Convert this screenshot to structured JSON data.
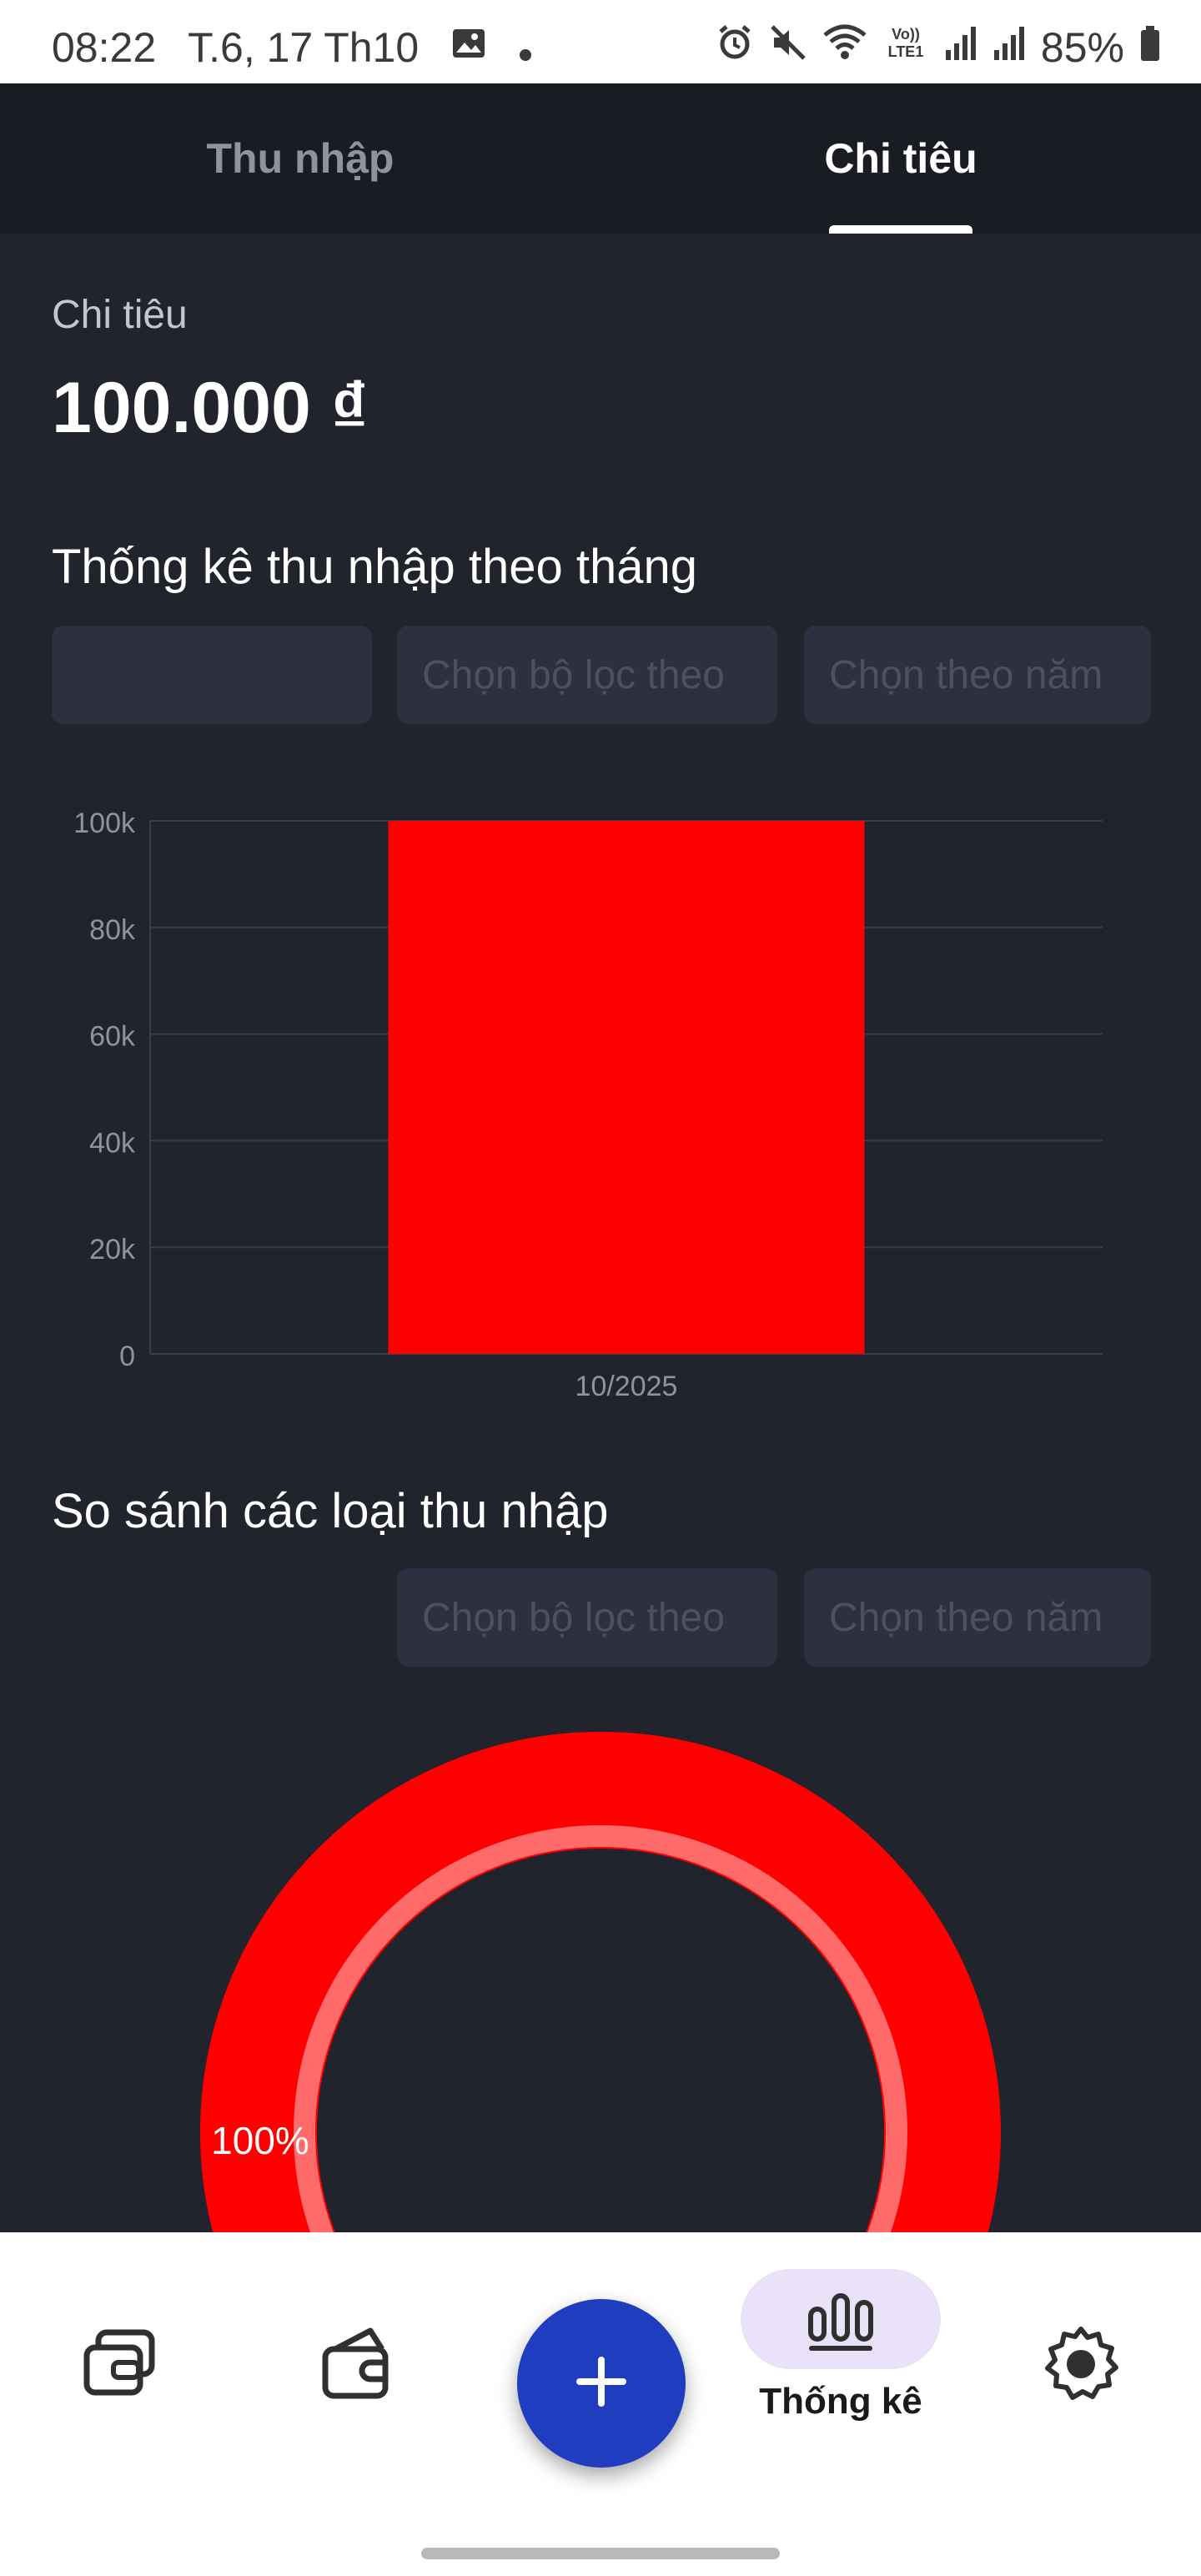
{
  "status_bar": {
    "time": "08:22",
    "date": "T.6, 17 Th10",
    "battery": "85%",
    "icons": [
      "gallery-icon",
      "dot-icon",
      "alarm-icon",
      "mute-icon",
      "wifi-icon",
      "volte-icon",
      "signal-icon",
      "signal-icon",
      "battery-icon"
    ],
    "volte_label": "Vo)) LTE1"
  },
  "tabs": [
    {
      "label": "Thu nhập",
      "active": false
    },
    {
      "label": "Chi tiêu",
      "active": true
    }
  ],
  "summary": {
    "label": "Chi tiêu",
    "amount": "100.000 ₫"
  },
  "monthly_section": {
    "title": "Thống kê thu nhập theo tháng",
    "filter_1": "",
    "filter_2_placeholder": "Chọn bộ lọc theo",
    "filter_3_placeholder": "Chọn theo năm"
  },
  "compare_section": {
    "title": "So sánh các loại thu nhập",
    "filter_1_placeholder": "Chọn bộ lọc theo",
    "filter_2_placeholder": "Chọn theo năm"
  },
  "chart_data": [
    {
      "type": "bar",
      "categories": [
        "10/2025"
      ],
      "values": [
        100000
      ],
      "ylim": [
        0,
        100000
      ],
      "yticks": [
        0,
        20000,
        40000,
        60000,
        80000,
        100000
      ],
      "ytick_labels": [
        "0",
        "20k",
        "40k",
        "60k",
        "80k",
        "100k"
      ],
      "grid": true,
      "bar_color": "#ff0000"
    },
    {
      "type": "pie",
      "variant": "donut",
      "values": [
        100
      ],
      "labels": [
        "100%"
      ],
      "colors": [
        "#ff0000"
      ],
      "highlight_color": "#ff6b6b"
    }
  ],
  "bottom_nav": {
    "items": [
      {
        "icon": "wallets-icon",
        "label": ""
      },
      {
        "icon": "wallet-icon",
        "label": ""
      },
      {
        "icon": "plus-icon",
        "label": ""
      },
      {
        "icon": "bar-chart-icon",
        "label": "Thống kê",
        "active": true
      },
      {
        "icon": "settings-icon",
        "label": ""
      }
    ]
  },
  "colors": {
    "background": "#21232d",
    "tabbar": "#1a1c24",
    "accent_fab": "#1f3ebf",
    "active_pill": "#e9e1f7",
    "bar": "#ff0000"
  }
}
